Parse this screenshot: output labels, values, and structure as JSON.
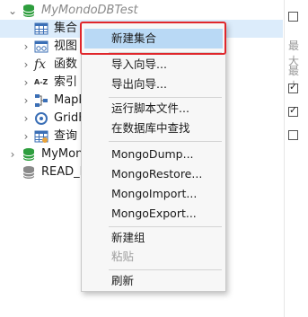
{
  "tree": {
    "connection_open": "MyMondoDBTest",
    "items": [
      {
        "label": "集合",
        "icon": "table-grid-icon"
      },
      {
        "label": "视图",
        "icon": "view-icon"
      },
      {
        "label": "函数",
        "icon": "function-icon"
      },
      {
        "label": "索引",
        "icon": "index-icon"
      },
      {
        "label": "MapReduce",
        "icon": "mapreduce-icon"
      },
      {
        "label": "GridFS",
        "icon": "gridfs-icon"
      },
      {
        "label": "查询",
        "icon": "query-icon"
      }
    ],
    "other_connections": [
      "MyMonoDB",
      "READ_DATA"
    ]
  },
  "right_panel": {
    "labels": [
      "最大",
      "最大"
    ]
  },
  "context_menu": {
    "items": [
      {
        "label": "新建集合",
        "state": "highlighted"
      },
      {
        "label": "导入向导..."
      },
      {
        "label": "导出向导..."
      },
      {
        "label": "运行脚本文件..."
      },
      {
        "label": "在数据库中查找"
      },
      {
        "label": "MongoDump..."
      },
      {
        "label": "MongoRestore..."
      },
      {
        "label": "MongoImport..."
      },
      {
        "label": "MongoExport..."
      },
      {
        "label": "新建组"
      },
      {
        "label": "粘贴",
        "state": "disabled"
      },
      {
        "label": "刷新"
      }
    ]
  },
  "colors": {
    "selection": "#dcecfb",
    "menu_highlight": "#b9d9f5",
    "annotation_red": "#e0262b",
    "db_green": "#2e9e3e"
  }
}
